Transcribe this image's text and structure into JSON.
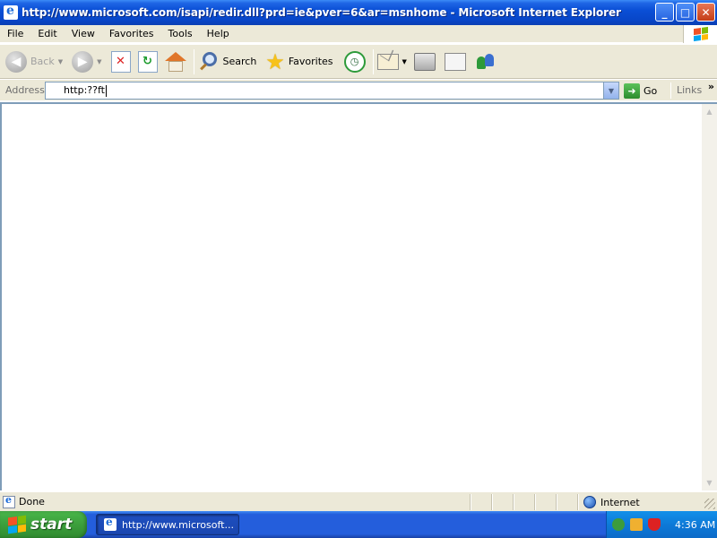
{
  "window": {
    "title": "http://www.microsoft.com/isapi/redir.dll?prd=ie&pver=6&ar=msnhome - Microsoft Internet Explorer",
    "controls": {
      "minimize": "minimize",
      "maximize": "maximize",
      "close": "close"
    }
  },
  "menu": {
    "items": [
      "File",
      "Edit",
      "View",
      "Favorites",
      "Tools",
      "Help"
    ]
  },
  "toolbar": {
    "back_label": "Back",
    "search_label": "Search",
    "favorites_label": "Favorites"
  },
  "address_bar": {
    "label": "Address",
    "value": "http:??ft",
    "go_label": "Go",
    "links_label": "Links"
  },
  "status_bar": {
    "text": "Done",
    "zone": "Internet"
  },
  "taskbar": {
    "start_label": "start",
    "task_label": "http://www.microsoft...",
    "clock": "4:36 AM"
  },
  "colors": {
    "titlebar": "#0a4fd6",
    "chrome": "#ece9d8",
    "taskbar": "#245edc",
    "start_button": "#3c9f3c",
    "tray": "#0d7ad8"
  }
}
